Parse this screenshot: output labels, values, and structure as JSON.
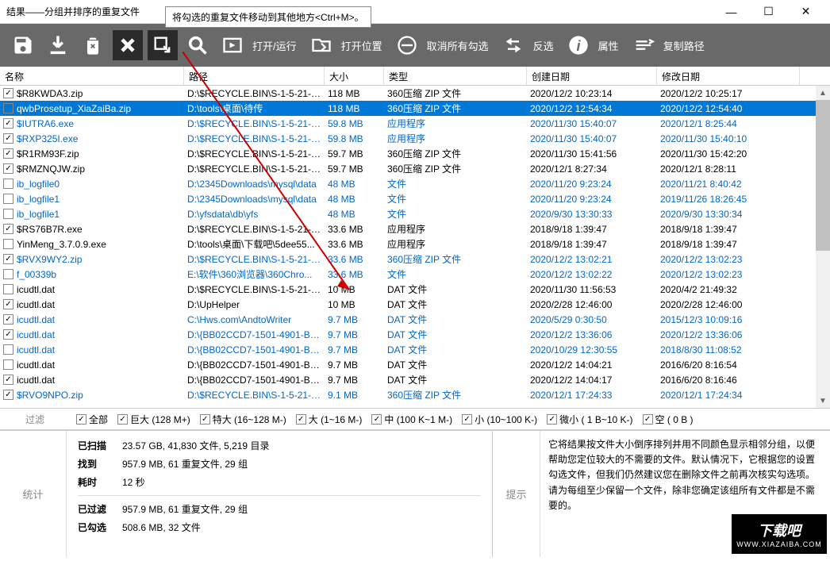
{
  "window": {
    "title": "结果——分组并排序的重复文件"
  },
  "tooltip": "将勾选的重复文件移动到其他地方<Ctrl+M>。",
  "toolbar": {
    "open_run": "打开/运行",
    "open_loc": "打开位置",
    "uncheck_all": "取消所有勾选",
    "invert": "反选",
    "properties": "属性",
    "copy_path": "复制路径"
  },
  "columns": {
    "name": "名称",
    "path": "路径",
    "size": "大小",
    "type": "类型",
    "created": "创建日期",
    "modified": "修改日期"
  },
  "rows": [
    {
      "chk": true,
      "name": "$R8KWDA3.zip",
      "path": "D:\\$RECYCLE.BIN\\S-1-5-21-21...",
      "size": "118 MB",
      "type": "360压缩 ZIP 文件",
      "created": "2020/12/2 10:23:14",
      "modified": "2020/12/2 10:25:17",
      "blue": false,
      "sel": false
    },
    {
      "chk": false,
      "name": "qwbProsetup_XiaZaiBa.zip",
      "path": "D:\\tools\\桌面\\待传",
      "size": "118 MB",
      "type": "360压缩 ZIP 文件",
      "created": "2020/12/2 12:54:34",
      "modified": "2020/12/2 12:54:40",
      "blue": false,
      "sel": true
    },
    {
      "chk": true,
      "name": "$IUTRA6.exe",
      "path": "D:\\$RECYCLE.BIN\\S-1-5-21-21...",
      "size": "59.8 MB",
      "type": "应用程序",
      "created": "2020/11/30 15:40:07",
      "modified": "2020/12/1 8:25:44",
      "blue": true,
      "sel": false
    },
    {
      "chk": true,
      "name": "$RXP325I.exe",
      "path": "D:\\$RECYCLE.BIN\\S-1-5-21-21...",
      "size": "59.8 MB",
      "type": "应用程序",
      "created": "2020/11/30 15:40:07",
      "modified": "2020/11/30 15:40:10",
      "blue": true,
      "sel": false
    },
    {
      "chk": true,
      "name": "$R1RM93F.zip",
      "path": "D:\\$RECYCLE.BIN\\S-1-5-21-21...",
      "size": "59.7 MB",
      "type": "360压缩 ZIP 文件",
      "created": "2020/11/30 15:41:56",
      "modified": "2020/11/30 15:42:20",
      "blue": false,
      "sel": false
    },
    {
      "chk": true,
      "name": "$RMZNQJW.zip",
      "path": "D:\\$RECYCLE.BIN\\S-1-5-21-21...",
      "size": "59.7 MB",
      "type": "360压缩 ZIP 文件",
      "created": "2020/12/1 8:27:34",
      "modified": "2020/12/1 8:28:11",
      "blue": false,
      "sel": false
    },
    {
      "chk": false,
      "name": "ib_logfile0",
      "path": "D:\\2345Downloads\\mysql\\data",
      "size": "48 MB",
      "type": "文件",
      "created": "2020/11/20 9:23:24",
      "modified": "2020/11/21 8:40:42",
      "blue": true,
      "sel": false
    },
    {
      "chk": false,
      "name": "ib_logfile1",
      "path": "D:\\2345Downloads\\mysql\\data",
      "size": "48 MB",
      "type": "文件",
      "created": "2020/11/20 9:23:24",
      "modified": "2019/11/26 18:26:45",
      "blue": true,
      "sel": false
    },
    {
      "chk": false,
      "name": "ib_logfile1",
      "path": "D:\\yfsdata\\db\\yfs",
      "size": "48 MB",
      "type": "文件",
      "created": "2020/9/30 13:30:33",
      "modified": "2020/9/30 13:30:34",
      "blue": true,
      "sel": false
    },
    {
      "chk": true,
      "name": "$RS76B7R.exe",
      "path": "D:\\$RECYCLE.BIN\\S-1-5-21-21...",
      "size": "33.6 MB",
      "type": "应用程序",
      "created": "2018/9/18 1:39:47",
      "modified": "2018/9/18 1:39:47",
      "blue": false,
      "sel": false
    },
    {
      "chk": false,
      "name": "YinMeng_3.7.0.9.exe",
      "path": "D:\\tools\\桌面\\下载吧\\5dee55...",
      "size": "33.6 MB",
      "type": "应用程序",
      "created": "2018/9/18 1:39:47",
      "modified": "2018/9/18 1:39:47",
      "blue": false,
      "sel": false
    },
    {
      "chk": true,
      "name": "$RVX9WY2.zip",
      "path": "D:\\$RECYCLE.BIN\\S-1-5-21-21...",
      "size": "33.6 MB",
      "type": "360压缩 ZIP 文件",
      "created": "2020/12/2 13:02:21",
      "modified": "2020/12/2 13:02:23",
      "blue": true,
      "sel": false
    },
    {
      "chk": false,
      "name": "f_00339b",
      "path": "E:\\软件\\360浏览器\\360Chro...",
      "size": "33.6 MB",
      "type": "文件",
      "created": "2020/12/2 13:02:22",
      "modified": "2020/12/2 13:02:23",
      "blue": true,
      "sel": false
    },
    {
      "chk": false,
      "name": "icudtl.dat",
      "path": "D:\\$RECYCLE.BIN\\S-1-5-21-21...",
      "size": "10 MB",
      "type": "DAT 文件",
      "created": "2020/11/30 11:56:53",
      "modified": "2020/4/2 21:49:32",
      "blue": false,
      "sel": false
    },
    {
      "chk": true,
      "name": "icudtl.dat",
      "path": "D:\\UpHelper",
      "size": "10 MB",
      "type": "DAT 文件",
      "created": "2020/2/28 12:46:00",
      "modified": "2020/2/28 12:46:00",
      "blue": false,
      "sel": false
    },
    {
      "chk": true,
      "name": "icudtl.dat",
      "path": "C:\\Hws.com\\AndtoWriter",
      "size": "9.7 MB",
      "type": "DAT 文件",
      "created": "2020/5/29 0:30:50",
      "modified": "2015/12/3 10:09:16",
      "blue": true,
      "sel": false
    },
    {
      "chk": true,
      "name": "icudtl.dat",
      "path": "D:\\{BB02CCD7-1501-4901-B5E...",
      "size": "9.7 MB",
      "type": "DAT 文件",
      "created": "2020/12/2 13:36:06",
      "modified": "2020/12/2 13:36:06",
      "blue": true,
      "sel": false
    },
    {
      "chk": false,
      "name": "icudtl.dat",
      "path": "D:\\{BB02CCD7-1501-4901-B5E...",
      "size": "9.7 MB",
      "type": "DAT 文件",
      "created": "2020/10/29 12:30:55",
      "modified": "2018/8/30 11:08:52",
      "blue": true,
      "sel": false
    },
    {
      "chk": false,
      "name": "icudtl.dat",
      "path": "D:\\{BB02CCD7-1501-4901-B5E...",
      "size": "9.7 MB",
      "type": "DAT 文件",
      "created": "2020/12/2 14:04:21",
      "modified": "2016/6/20 8:16:54",
      "blue": false,
      "sel": false
    },
    {
      "chk": true,
      "name": "icudtl.dat",
      "path": "D:\\{BB02CCD7-1501-4901-B5E...",
      "size": "9.7 MB",
      "type": "DAT 文件",
      "created": "2020/12/2 14:04:17",
      "modified": "2016/6/20 8:16:46",
      "blue": false,
      "sel": false
    },
    {
      "chk": true,
      "name": "$RVO9NPO.zip",
      "path": "D:\\$RECYCLE.BIN\\S-1-5-21-21...",
      "size": "9.1 MB",
      "type": "360压缩 ZIP 文件",
      "created": "2020/12/1 17:24:33",
      "modified": "2020/12/1 17:24:34",
      "blue": true,
      "sel": false
    }
  ],
  "filter": {
    "label": "过滤",
    "all": "全部",
    "huge": "巨大  (128 M+)",
    "big": "特大  (16~128 M-)",
    "large": "大  (1~16 M-)",
    "medium": "中  (100 K~1 M-)",
    "small": "小  (10~100 K-)",
    "tiny": "微小  ( 1 B~10 K-)",
    "empty": "空  ( 0 B )"
  },
  "stats": {
    "label": "统计",
    "scanned_k": "已扫描",
    "scanned_v": "23.57 GB, 41,830 文件, 5,219 目录",
    "found_k": "找到",
    "found_v": "957.9 MB, 61 重复文件, 29 组",
    "time_k": "耗时",
    "time_v": "12 秒",
    "filtered_k": "已过滤",
    "filtered_v": "957.9 MB, 61 重复文件, 29 组",
    "checked_k": "已勾选",
    "checked_v": "508.6 MB, 32 文件"
  },
  "tips": {
    "label": "提示",
    "text": "它将结果按文件大小倒序排列并用不同颜色显示相邻分组，以便帮助您定位较大的不需要的文件。默认情况下，它根据您的设置勾选文件，但我们仍然建议您在删除文件之前再次核实勾选项。请为每组至少保留一个文件，除非您确定该组所有文件都是不需要的。"
  },
  "watermark": {
    "main": "下载吧",
    "sub": "WWW.XIAZAIBA.COM"
  }
}
